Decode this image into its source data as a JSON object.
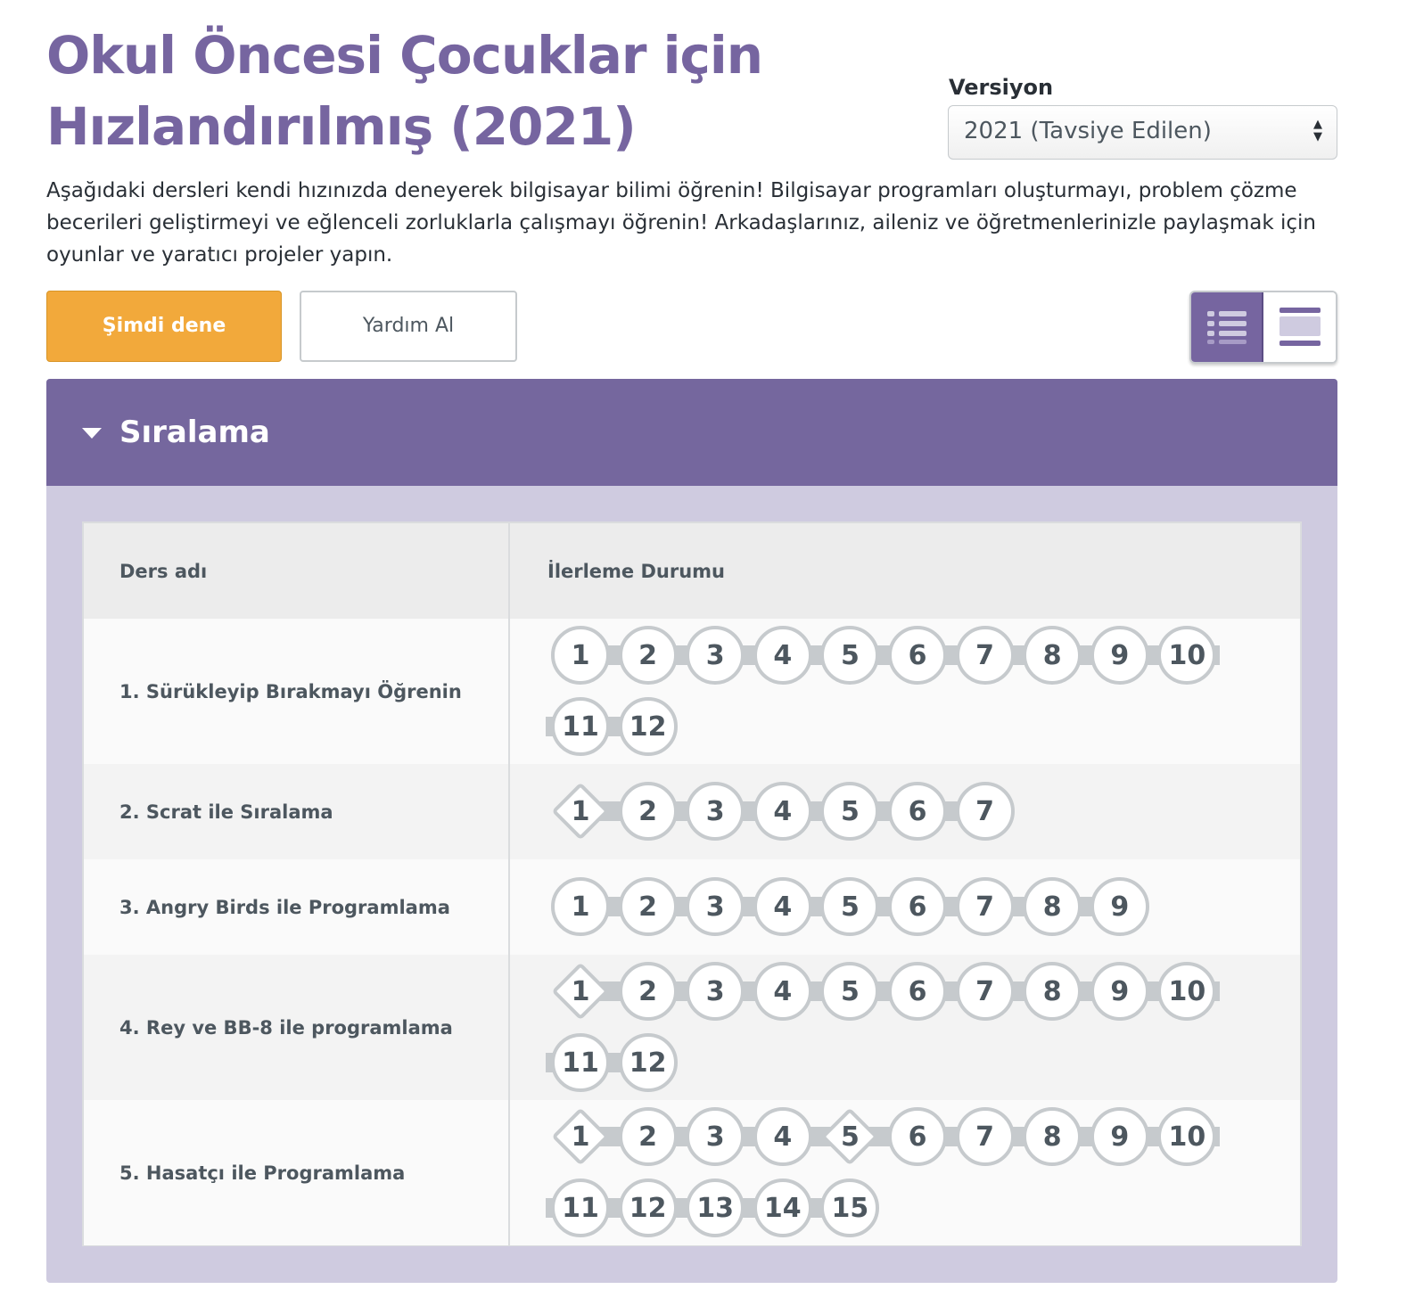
{
  "title": "Okul Öncesi Çocuklar için Hızlandırılmış (2021)",
  "version": {
    "label": "Versiyon",
    "selected": "2021 (Tavsiye Edilen)"
  },
  "description": "Aşağıdaki dersleri kendi hızınızda deneyerek bilgisayar bilimi öğrenin! Bilgisayar programları oluşturmayı, problem çözme becerileri geliştirmeyi ve eğlenceli zorluklarla çalışmayı öğrenin! Arkadaşlarınız, aileniz ve öğretmenlerinizle paylaşmak için oyunlar ve yaratıcı projeler yapın.",
  "buttons": {
    "try_now": "Şimdi dene",
    "get_help": "Yardım Al"
  },
  "view_toggle": {
    "active": "list-view-icon",
    "inactive": "card-view-icon"
  },
  "section": {
    "title": "Sıralama",
    "columns": [
      "Ders adı",
      "İlerleme Durumu"
    ],
    "lessons": [
      {
        "name": "1. Sürükleyip Bırakmayı Öğrenin",
        "levels": [
          "1",
          "2",
          "3",
          "4",
          "5",
          "6",
          "7",
          "8",
          "9",
          "10",
          "11",
          "12"
        ],
        "diamonds": []
      },
      {
        "name": "2. Scrat ile Sıralama",
        "levels": [
          "1",
          "2",
          "3",
          "4",
          "5",
          "6",
          "7"
        ],
        "diamonds": [
          1
        ]
      },
      {
        "name": "3. Angry Birds ile Programlama",
        "levels": [
          "1",
          "2",
          "3",
          "4",
          "5",
          "6",
          "7",
          "8",
          "9"
        ],
        "diamonds": []
      },
      {
        "name": "4. Rey ve BB-8 ile programlama",
        "levels": [
          "1",
          "2",
          "3",
          "4",
          "5",
          "6",
          "7",
          "8",
          "9",
          "10",
          "11",
          "12"
        ],
        "diamonds": [
          1
        ]
      },
      {
        "name": "5. Hasatçı ile Programlama",
        "levels": [
          "1",
          "2",
          "3",
          "4",
          "5",
          "6",
          "7",
          "8",
          "9",
          "10",
          "11",
          "12",
          "13",
          "14",
          "15"
        ],
        "diamonds": [
          1,
          5
        ]
      }
    ]
  },
  "colors": {
    "brand_purple": "#7665a0",
    "header_purple": "#75679e",
    "section_bg": "#cfcbe0",
    "try_button": "#f2a93b",
    "bubble_border": "#c6cacd"
  }
}
